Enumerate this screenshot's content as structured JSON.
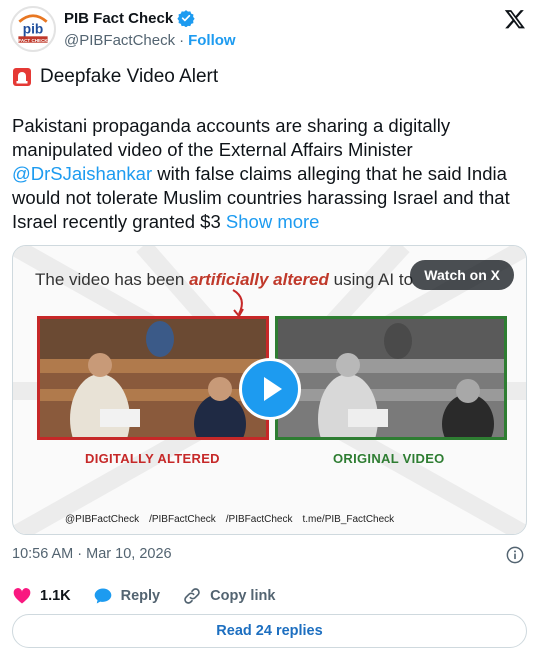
{
  "header": {
    "account_name": "PIB Fact Check",
    "handle": "@PIBFactCheck",
    "separator": "·",
    "follow_label": "Follow",
    "logo_text": "pib",
    "logo_sub": "FACT CHECK"
  },
  "tweet": {
    "alert_title": "Deepfake Video Alert",
    "text_part1": "Pakistani propaganda accounts are sharing a digitally manipulated video of the External Affairs Minister ",
    "mention": "@DrSJaishankar",
    "text_part2": " with false claims alleging that he said India would not tolerate Muslim countries harassing Israel and that Israel recently granted $3",
    "show_more": "Show more"
  },
  "media": {
    "watch_label": "Watch on X",
    "headline_prefix": "The video has been ",
    "headline_emph": "artificially altered",
    "headline_suffix": " using AI to",
    "left_label": "DIGITALLY ALTERED",
    "right_label": "ORIGINAL VIDEO",
    "social": [
      "@PIBFactCheck",
      "/PIBFactCheck",
      "/PIBFactCheck",
      "t.me/PIB_FactCheck"
    ]
  },
  "meta": {
    "timestamp": "10:56 AM · Mar 10, 2026"
  },
  "actions": {
    "likes": "1.1K",
    "reply_label": "Reply",
    "copy_label": "Copy link"
  },
  "replies": {
    "label": "Read 24 replies"
  },
  "colors": {
    "accent": "#1d9bf0",
    "like": "#f91880",
    "altered": "#c62828",
    "original": "#2e7d32"
  }
}
